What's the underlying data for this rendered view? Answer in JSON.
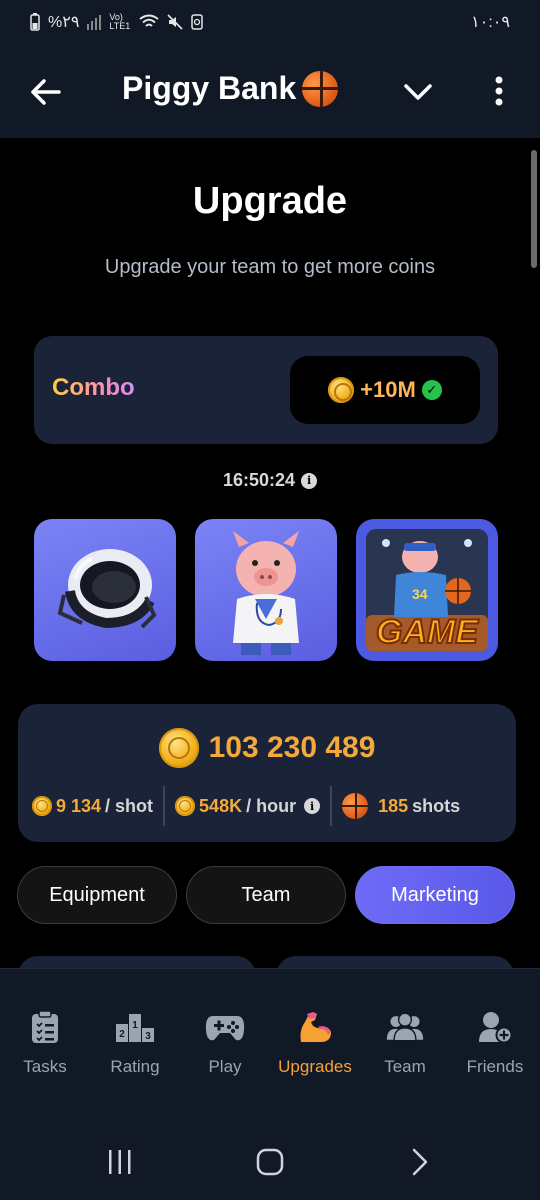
{
  "status_bar": {
    "battery": "%۲۹",
    "network": "Vo) LTE1",
    "time": "۱۰:۰۹"
  },
  "header": {
    "title": "Piggy Bank",
    "icons": {
      "back": "back-arrow-icon",
      "menu_toggle": "chevron-down-icon",
      "more": "more-vertical-icon",
      "title_emoji": "basketball-icon"
    }
  },
  "upgrade": {
    "title": "Upgrade",
    "subtitle": "Upgrade your team to get more coins"
  },
  "combo": {
    "label": "Combo",
    "reward": "+10M",
    "timer": "16:50:24",
    "cards": [
      {
        "name": "neck-pillow"
      },
      {
        "name": "doctor-pig"
      },
      {
        "name": "game-pig",
        "text": "GAME",
        "jersey": "34"
      }
    ]
  },
  "balance": {
    "amount": "103 230 489",
    "per_shot_value": "9 134",
    "per_shot_unit": "/ shot",
    "per_hour_value": "548K",
    "per_hour_unit": "/ hour",
    "shots_value": "185",
    "shots_unit": "shots"
  },
  "tabs": [
    {
      "label": "Equipment",
      "active": false
    },
    {
      "label": "Team",
      "active": false
    },
    {
      "label": "Marketing",
      "active": true
    }
  ],
  "bottom_nav": [
    {
      "label": "Tasks",
      "icon": "clipboard-icon",
      "active": false
    },
    {
      "label": "Rating",
      "icon": "podium-icon",
      "active": false
    },
    {
      "label": "Play",
      "icon": "gamepad-icon",
      "active": false
    },
    {
      "label": "Upgrades",
      "icon": "flexed-arm-icon",
      "active": true
    },
    {
      "label": "Team",
      "icon": "users-icon",
      "active": false
    },
    {
      "label": "Friends",
      "icon": "add-friend-icon",
      "active": false
    }
  ],
  "colors": {
    "accent": "#f7a134",
    "active_tab": "#6e6cf6",
    "card_bg": "#1a2337",
    "header_bg": "#111926",
    "success": "#27c24c"
  }
}
